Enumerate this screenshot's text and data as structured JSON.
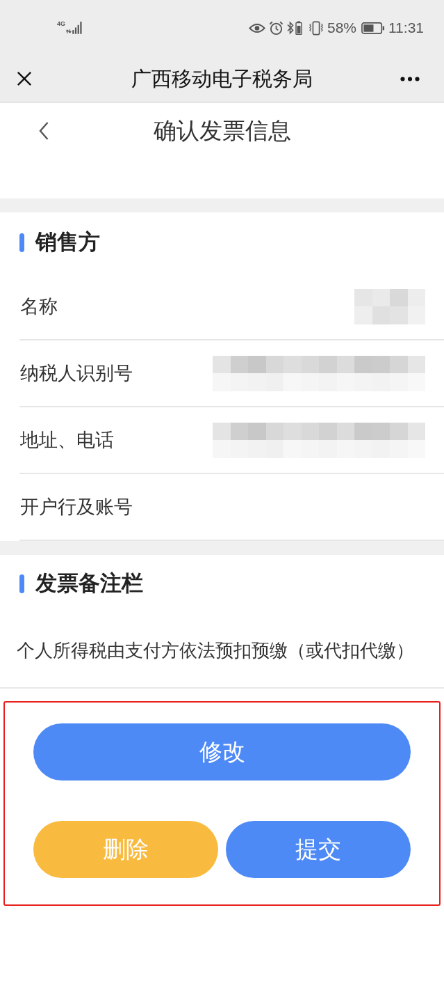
{
  "status_bar": {
    "network": "4G",
    "battery_percent": "58%",
    "time": "11:31"
  },
  "nav_bar": {
    "title": "广西移动电子税务局"
  },
  "page_header": {
    "title": "确认发票信息"
  },
  "seller": {
    "title": "销售方",
    "rows": [
      {
        "label": "名称",
        "kind": "mosaicshort"
      },
      {
        "label": "纳税人识别号",
        "kind": "mosaiclong"
      },
      {
        "label": "地址、电话",
        "kind": "mosaiclong"
      },
      {
        "label": "开户行及账号",
        "kind": "plain"
      }
    ]
  },
  "remarks": {
    "title": "发票备注栏",
    "text": "个人所得税由支付方依法预扣预缴（或代扣代缴）"
  },
  "actions": {
    "highlighted": true,
    "buttons": [
      {
        "label": "修改",
        "kind": "primary",
        "full_width": true
      },
      {
        "label": "删除",
        "kind": "warning",
        "full_width": false
      },
      {
        "label": "提交",
        "kind": "primary",
        "full_width": false
      }
    ]
  }
}
